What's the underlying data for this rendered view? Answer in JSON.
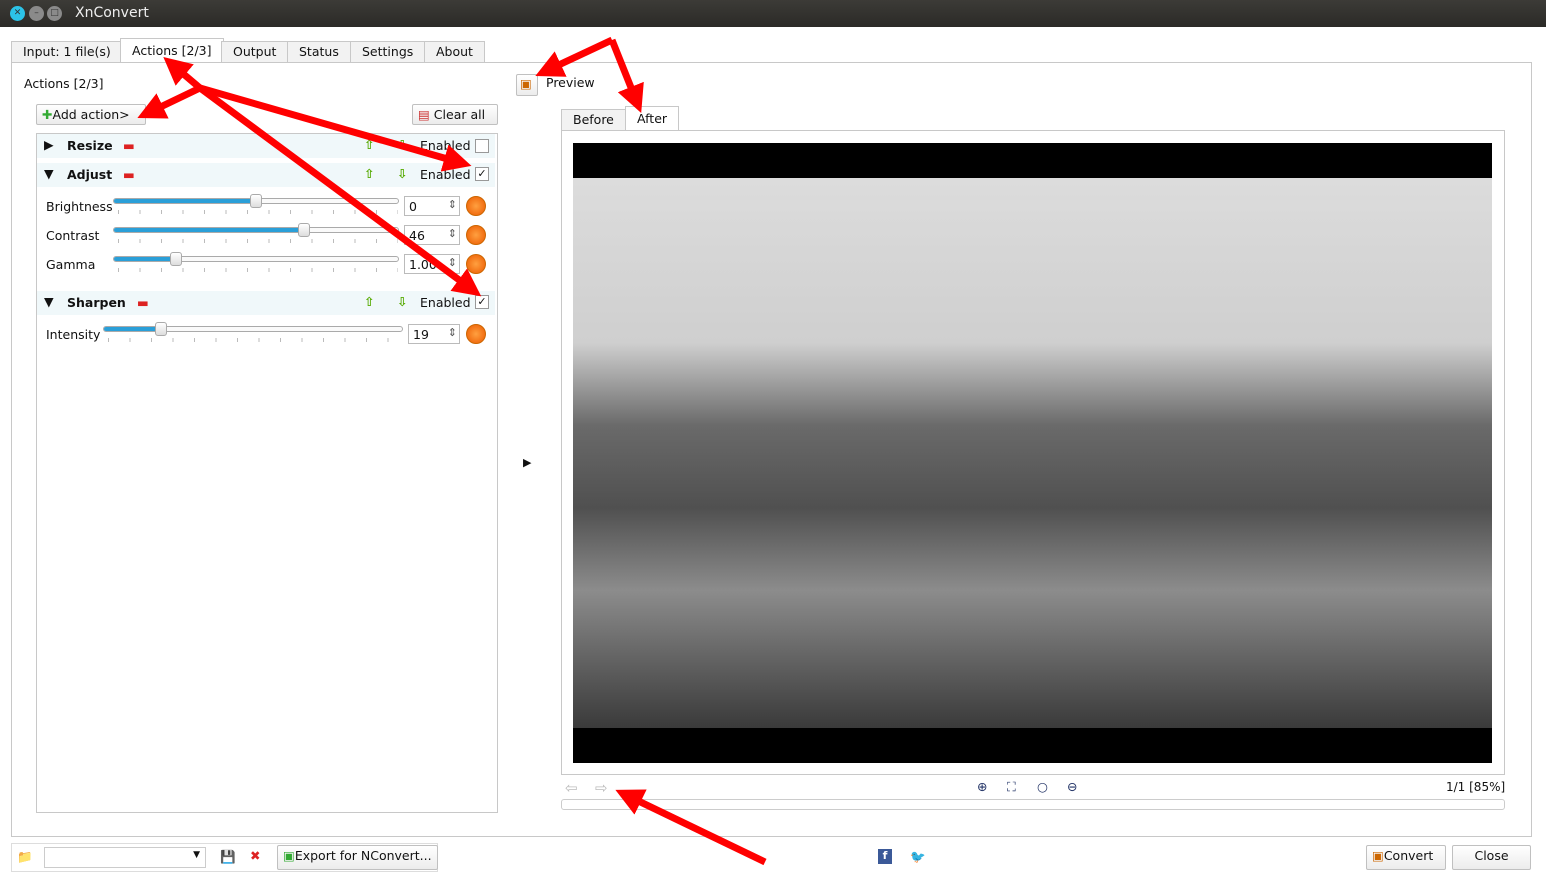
{
  "window": {
    "title": "XnConvert"
  },
  "tabs": [
    {
      "label": "Input: 1 file(s)"
    },
    {
      "label": "Actions [2/3]"
    },
    {
      "label": "Output"
    },
    {
      "label": "Status"
    },
    {
      "label": "Settings"
    },
    {
      "label": "About"
    }
  ],
  "actions": {
    "heading": "Actions [2/3]",
    "add_label": "Add action>",
    "clear_label": "Clear all",
    "enabled_label": "Enabled",
    "sections": [
      {
        "title": "Resize",
        "enabled": false,
        "expanded": false
      },
      {
        "title": "Adjust",
        "enabled": true,
        "expanded": true,
        "params": [
          {
            "label": "Brightness",
            "value": "0",
            "slider": 0.5
          },
          {
            "label": "Contrast",
            "value": "46",
            "slider": 0.67
          },
          {
            "label": "Gamma",
            "value": "1.00",
            "slider": 0.22
          }
        ]
      },
      {
        "title": "Sharpen",
        "enabled": true,
        "expanded": true,
        "params": [
          {
            "label": "Intensity",
            "value": "19",
            "slider": 0.19
          }
        ]
      }
    ]
  },
  "preview": {
    "label": "Preview",
    "tabs": [
      {
        "label": "Before"
      },
      {
        "label": "After"
      }
    ],
    "active_tab": "After",
    "status": "1/1 [85%]"
  },
  "bottom": {
    "preset_value": "",
    "export_label": "Export for NConvert...",
    "convert_label": "Convert",
    "close_label": "Close"
  },
  "colors": {
    "accent": "#2a9fd8",
    "annotation": "#ff0000"
  }
}
